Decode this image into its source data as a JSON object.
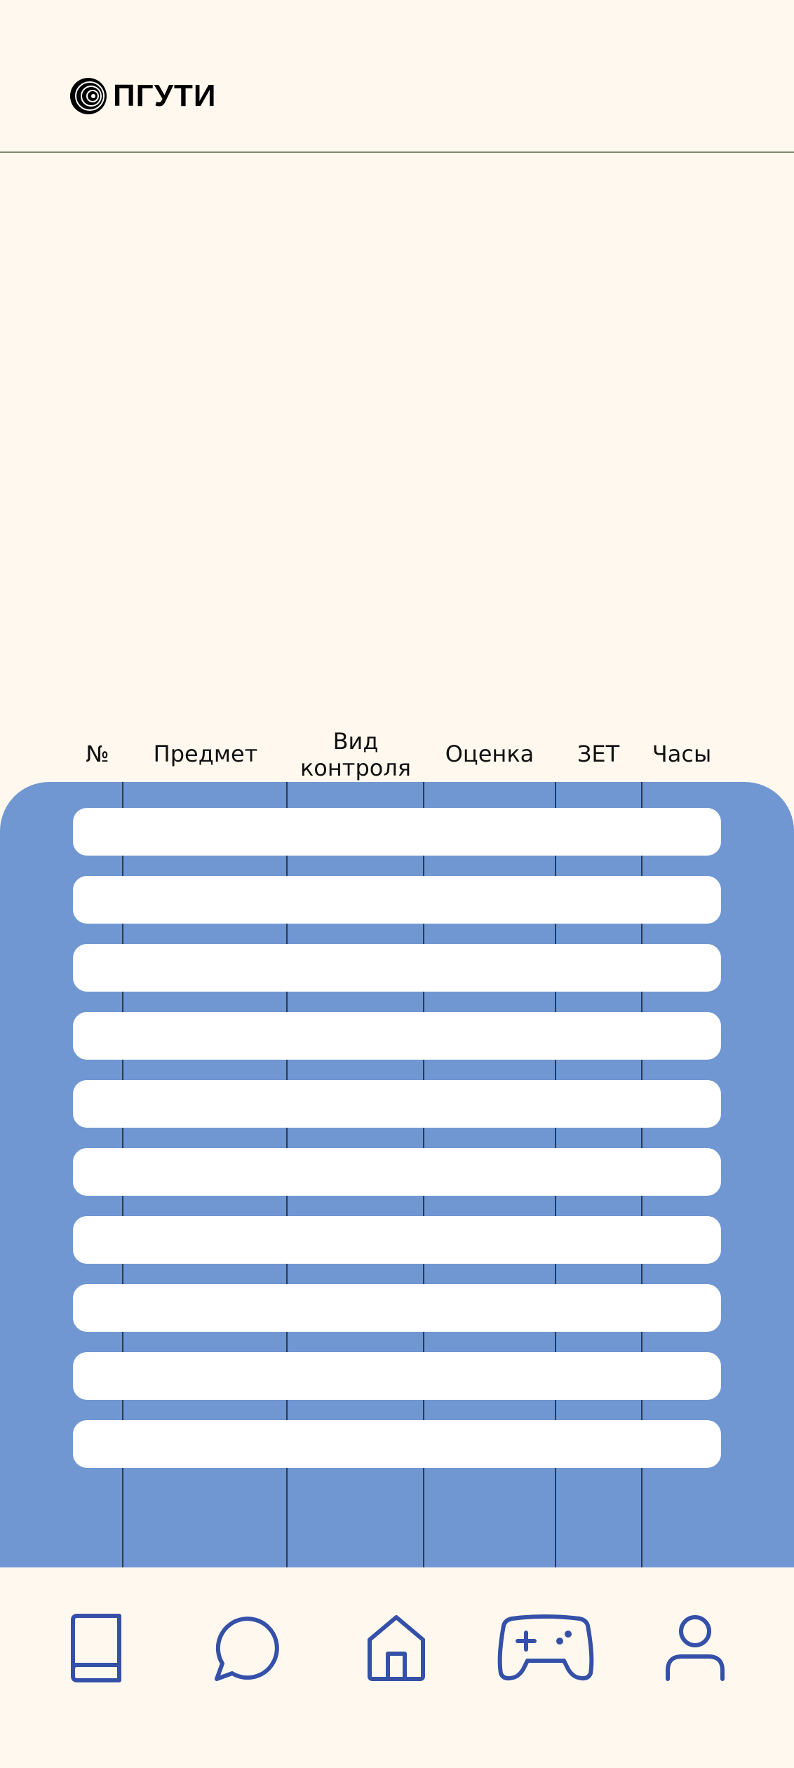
{
  "header": {
    "logo_text": "ПГУТИ"
  },
  "table": {
    "columns": [
      "№",
      "Предмет",
      "Вид\nконтроля",
      "Оценка",
      "ЗЕТ",
      "Часы"
    ],
    "rows": [
      [
        "",
        "",
        "",
        "",
        "",
        ""
      ],
      [
        "",
        "",
        "",
        "",
        "",
        ""
      ],
      [
        "",
        "",
        "",
        "",
        "",
        ""
      ],
      [
        "",
        "",
        "",
        "",
        "",
        ""
      ],
      [
        "",
        "",
        "",
        "",
        "",
        ""
      ],
      [
        "",
        "",
        "",
        "",
        "",
        ""
      ],
      [
        "",
        "",
        "",
        "",
        "",
        ""
      ],
      [
        "",
        "",
        "",
        "",
        "",
        ""
      ],
      [
        "",
        "",
        "",
        "",
        "",
        ""
      ],
      [
        "",
        "",
        "",
        "",
        "",
        ""
      ]
    ]
  },
  "nav": {
    "items": [
      {
        "icon": "book-icon"
      },
      {
        "icon": "chat-icon"
      },
      {
        "icon": "home-icon"
      },
      {
        "icon": "gamepad-icon"
      },
      {
        "icon": "user-icon"
      }
    ]
  },
  "colors": {
    "background": "#FFF8EE",
    "panel": "#7097D2",
    "row": "#FFFFFF",
    "nav_icon": "#3450A8",
    "header_line": "#7E8C6E"
  }
}
